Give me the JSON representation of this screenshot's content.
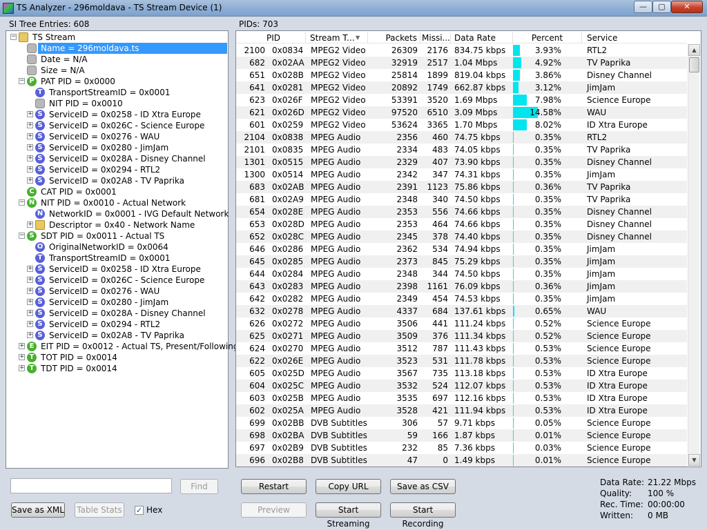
{
  "window": {
    "title": "TS Analyzer - 296moldava - TS Stream Device (1)",
    "minimize": "—",
    "maximize": "▢",
    "close": "✕"
  },
  "left": {
    "header": "SI Tree Entries: 608",
    "find_button": "Find",
    "save_xml_button": "Save as XML",
    "table_stats_button": "Table Stats",
    "hex_label": "Hex",
    "hex_checked": "✓",
    "search_value": ""
  },
  "tree": [
    {
      "label": "TS Stream",
      "icon": "folder",
      "letter": "",
      "color": "#e8c860",
      "level": 0,
      "exp": "−"
    },
    {
      "label": "Name = 296moldava.ts",
      "icon": "leaf",
      "letter": "",
      "color": "#b8b8b8",
      "level": 1,
      "exp": "",
      "sel": true
    },
    {
      "label": "Date = N/A",
      "icon": "leaf",
      "letter": "",
      "color": "#b8b8b8",
      "level": 1,
      "exp": ""
    },
    {
      "label": "Size = N/A",
      "icon": "leaf",
      "letter": "",
      "color": "#b8b8b8",
      "level": 1,
      "exp": ""
    },
    {
      "label": "PAT PID = 0x0000",
      "icon": "P",
      "letter": "P",
      "color": "#48b030",
      "level": 1,
      "exp": "−"
    },
    {
      "label": "TransportStreamID = 0x0001",
      "icon": "T",
      "letter": "T",
      "color": "#5860d8",
      "level": 2,
      "exp": ""
    },
    {
      "label": "NIT PID = 0x0010",
      "icon": "leaf",
      "letter": "",
      "color": "#b8b8b8",
      "level": 2,
      "exp": ""
    },
    {
      "label": "ServiceID = 0x0258 - ID Xtra Europe",
      "icon": "S",
      "letter": "S",
      "color": "#5860d8",
      "level": 2,
      "exp": "+"
    },
    {
      "label": "ServiceID = 0x026C - Science Europe",
      "icon": "S",
      "letter": "S",
      "color": "#5860d8",
      "level": 2,
      "exp": "+"
    },
    {
      "label": "ServiceID = 0x0276 - WAU",
      "icon": "S",
      "letter": "S",
      "color": "#5860d8",
      "level": 2,
      "exp": "+"
    },
    {
      "label": "ServiceID = 0x0280 - JimJam",
      "icon": "S",
      "letter": "S",
      "color": "#5860d8",
      "level": 2,
      "exp": "+"
    },
    {
      "label": "ServiceID = 0x028A - Disney Channel",
      "icon": "S",
      "letter": "S",
      "color": "#5860d8",
      "level": 2,
      "exp": "+"
    },
    {
      "label": "ServiceID = 0x0294 - RTL2",
      "icon": "S",
      "letter": "S",
      "color": "#5860d8",
      "level": 2,
      "exp": "+"
    },
    {
      "label": "ServiceID = 0x02A8 - TV Paprika",
      "icon": "S",
      "letter": "S",
      "color": "#5860d8",
      "level": 2,
      "exp": "+"
    },
    {
      "label": "CAT PID = 0x0001",
      "icon": "C",
      "letter": "C",
      "color": "#48b030",
      "level": 1,
      "exp": ""
    },
    {
      "label": "NIT PID = 0x0010 - Actual Network",
      "icon": "N",
      "letter": "N",
      "color": "#48b030",
      "level": 1,
      "exp": "−"
    },
    {
      "label": "NetworkID = 0x0001 - IVG Default Network",
      "icon": "N",
      "letter": "N",
      "color": "#5860d8",
      "level": 2,
      "exp": ""
    },
    {
      "label": "Descriptor = 0x40 - Network Name",
      "icon": "folder",
      "letter": "",
      "color": "#e8c860",
      "level": 2,
      "exp": "+"
    },
    {
      "label": "SDT PID = 0x0011 - Actual TS",
      "icon": "S",
      "letter": "S",
      "color": "#48b030",
      "level": 1,
      "exp": "−"
    },
    {
      "label": "OriginalNetworkID = 0x0064",
      "icon": "O",
      "letter": "O",
      "color": "#5860d8",
      "level": 2,
      "exp": ""
    },
    {
      "label": "TransportStreamID = 0x0001",
      "icon": "T",
      "letter": "T",
      "color": "#5860d8",
      "level": 2,
      "exp": ""
    },
    {
      "label": "ServiceID = 0x0258 - ID Xtra Europe",
      "icon": "S",
      "letter": "S",
      "color": "#5860d8",
      "level": 2,
      "exp": "+"
    },
    {
      "label": "ServiceID = 0x026C - Science Europe",
      "icon": "S",
      "letter": "S",
      "color": "#5860d8",
      "level": 2,
      "exp": "+"
    },
    {
      "label": "ServiceID = 0x0276 - WAU",
      "icon": "S",
      "letter": "S",
      "color": "#5860d8",
      "level": 2,
      "exp": "+"
    },
    {
      "label": "ServiceID = 0x0280 - JimJam",
      "icon": "S",
      "letter": "S",
      "color": "#5860d8",
      "level": 2,
      "exp": "+"
    },
    {
      "label": "ServiceID = 0x028A - Disney Channel",
      "icon": "S",
      "letter": "S",
      "color": "#5860d8",
      "level": 2,
      "exp": "+"
    },
    {
      "label": "ServiceID = 0x0294 - RTL2",
      "icon": "S",
      "letter": "S",
      "color": "#5860d8",
      "level": 2,
      "exp": "+"
    },
    {
      "label": "ServiceID = 0x02A8 - TV Paprika",
      "icon": "S",
      "letter": "S",
      "color": "#5860d8",
      "level": 2,
      "exp": "+"
    },
    {
      "label": "EIT PID = 0x0012 - Actual TS, Present/Following",
      "icon": "E",
      "letter": "E",
      "color": "#48b030",
      "level": 1,
      "exp": "+"
    },
    {
      "label": "TOT PID = 0x0014",
      "icon": "T",
      "letter": "T",
      "color": "#48b030",
      "level": 1,
      "exp": "+"
    },
    {
      "label": "TDT PID = 0x0014",
      "icon": "T",
      "letter": "T",
      "color": "#48b030",
      "level": 1,
      "exp": "+"
    }
  ],
  "right": {
    "header": "PIDs: 703",
    "columns": [
      "PID",
      "Stream T...",
      "Packets",
      "Missi...",
      "Data Rate",
      "Percent",
      "Service"
    ],
    "sort_arrow": "▼",
    "rows": [
      {
        "dec": "2100",
        "hex": "0x0834",
        "type": "MPEG2 Video",
        "packets": "26309",
        "missing": "2176",
        "rate": "834.75 kbps",
        "pct": "3.93%",
        "pctv": 3.93,
        "service": "RTL2"
      },
      {
        "dec": "682",
        "hex": "0x02AA",
        "type": "MPEG2 Video",
        "packets": "32919",
        "missing": "2517",
        "rate": "1.04 Mbps",
        "pct": "4.92%",
        "pctv": 4.92,
        "service": "TV Paprika"
      },
      {
        "dec": "651",
        "hex": "0x028B",
        "type": "MPEG2 Video",
        "packets": "25814",
        "missing": "1899",
        "rate": "819.04 kbps",
        "pct": "3.86%",
        "pctv": 3.86,
        "service": "Disney Channel"
      },
      {
        "dec": "641",
        "hex": "0x0281",
        "type": "MPEG2 Video",
        "packets": "20892",
        "missing": "1749",
        "rate": "662.87 kbps",
        "pct": "3.12%",
        "pctv": 3.12,
        "service": "JimJam"
      },
      {
        "dec": "623",
        "hex": "0x026F",
        "type": "MPEG2 Video",
        "packets": "53391",
        "missing": "3520",
        "rate": "1.69 Mbps",
        "pct": "7.98%",
        "pctv": 7.98,
        "service": "Science Europe"
      },
      {
        "dec": "621",
        "hex": "0x026D",
        "type": "MPEG2 Video",
        "packets": "97520",
        "missing": "6510",
        "rate": "3.09 Mbps",
        "pct": "14.58%",
        "pctv": 14.58,
        "service": "WAU"
      },
      {
        "dec": "601",
        "hex": "0x0259",
        "type": "MPEG2 Video",
        "packets": "53624",
        "missing": "3365",
        "rate": "1.70 Mbps",
        "pct": "8.02%",
        "pctv": 8.02,
        "service": "ID Xtra Europe"
      },
      {
        "dec": "2104",
        "hex": "0x0838",
        "type": "MPEG Audio",
        "packets": "2356",
        "missing": "460",
        "rate": "74.75 kbps",
        "pct": "0.35%",
        "pctv": 0.35,
        "service": "RTL2"
      },
      {
        "dec": "2101",
        "hex": "0x0835",
        "type": "MPEG Audio",
        "packets": "2334",
        "missing": "483",
        "rate": "74.05 kbps",
        "pct": "0.35%",
        "pctv": 0.35,
        "service": "TV Paprika"
      },
      {
        "dec": "1301",
        "hex": "0x0515",
        "type": "MPEG Audio",
        "packets": "2329",
        "missing": "407",
        "rate": "73.90 kbps",
        "pct": "0.35%",
        "pctv": 0.35,
        "service": "Disney Channel"
      },
      {
        "dec": "1300",
        "hex": "0x0514",
        "type": "MPEG Audio",
        "packets": "2342",
        "missing": "347",
        "rate": "74.31 kbps",
        "pct": "0.35%",
        "pctv": 0.35,
        "service": "JimJam"
      },
      {
        "dec": "683",
        "hex": "0x02AB",
        "type": "MPEG Audio",
        "packets": "2391",
        "missing": "1123",
        "rate": "75.86 kbps",
        "pct": "0.36%",
        "pctv": 0.36,
        "service": "TV Paprika"
      },
      {
        "dec": "681",
        "hex": "0x02A9",
        "type": "MPEG Audio",
        "packets": "2348",
        "missing": "340",
        "rate": "74.50 kbps",
        "pct": "0.35%",
        "pctv": 0.35,
        "service": "TV Paprika"
      },
      {
        "dec": "654",
        "hex": "0x028E",
        "type": "MPEG Audio",
        "packets": "2353",
        "missing": "556",
        "rate": "74.66 kbps",
        "pct": "0.35%",
        "pctv": 0.35,
        "service": "Disney Channel"
      },
      {
        "dec": "653",
        "hex": "0x028D",
        "type": "MPEG Audio",
        "packets": "2353",
        "missing": "464",
        "rate": "74.66 kbps",
        "pct": "0.35%",
        "pctv": 0.35,
        "service": "Disney Channel"
      },
      {
        "dec": "652",
        "hex": "0x028C",
        "type": "MPEG Audio",
        "packets": "2345",
        "missing": "378",
        "rate": "74.40 kbps",
        "pct": "0.35%",
        "pctv": 0.35,
        "service": "Disney Channel"
      },
      {
        "dec": "646",
        "hex": "0x0286",
        "type": "MPEG Audio",
        "packets": "2362",
        "missing": "534",
        "rate": "74.94 kbps",
        "pct": "0.35%",
        "pctv": 0.35,
        "service": "JimJam"
      },
      {
        "dec": "645",
        "hex": "0x0285",
        "type": "MPEG Audio",
        "packets": "2373",
        "missing": "845",
        "rate": "75.29 kbps",
        "pct": "0.35%",
        "pctv": 0.35,
        "service": "JimJam"
      },
      {
        "dec": "644",
        "hex": "0x0284",
        "type": "MPEG Audio",
        "packets": "2348",
        "missing": "344",
        "rate": "74.50 kbps",
        "pct": "0.35%",
        "pctv": 0.35,
        "service": "JimJam"
      },
      {
        "dec": "643",
        "hex": "0x0283",
        "type": "MPEG Audio",
        "packets": "2398",
        "missing": "1161",
        "rate": "76.09 kbps",
        "pct": "0.36%",
        "pctv": 0.36,
        "service": "JimJam"
      },
      {
        "dec": "642",
        "hex": "0x0282",
        "type": "MPEG Audio",
        "packets": "2349",
        "missing": "454",
        "rate": "74.53 kbps",
        "pct": "0.35%",
        "pctv": 0.35,
        "service": "JimJam"
      },
      {
        "dec": "632",
        "hex": "0x0278",
        "type": "MPEG Audio",
        "packets": "4337",
        "missing": "684",
        "rate": "137.61 kbps",
        "pct": "0.65%",
        "pctv": 0.65,
        "service": "WAU"
      },
      {
        "dec": "626",
        "hex": "0x0272",
        "type": "MPEG Audio",
        "packets": "3506",
        "missing": "441",
        "rate": "111.24 kbps",
        "pct": "0.52%",
        "pctv": 0.52,
        "service": "Science Europe"
      },
      {
        "dec": "625",
        "hex": "0x0271",
        "type": "MPEG Audio",
        "packets": "3509",
        "missing": "376",
        "rate": "111.34 kbps",
        "pct": "0.52%",
        "pctv": 0.52,
        "service": "Science Europe"
      },
      {
        "dec": "624",
        "hex": "0x0270",
        "type": "MPEG Audio",
        "packets": "3512",
        "missing": "787",
        "rate": "111.43 kbps",
        "pct": "0.53%",
        "pctv": 0.53,
        "service": "Science Europe"
      },
      {
        "dec": "622",
        "hex": "0x026E",
        "type": "MPEG Audio",
        "packets": "3523",
        "missing": "531",
        "rate": "111.78 kbps",
        "pct": "0.53%",
        "pctv": 0.53,
        "service": "Science Europe"
      },
      {
        "dec": "605",
        "hex": "0x025D",
        "type": "MPEG Audio",
        "packets": "3567",
        "missing": "735",
        "rate": "113.18 kbps",
        "pct": "0.53%",
        "pctv": 0.53,
        "service": "ID Xtra Europe"
      },
      {
        "dec": "604",
        "hex": "0x025C",
        "type": "MPEG Audio",
        "packets": "3532",
        "missing": "524",
        "rate": "112.07 kbps",
        "pct": "0.53%",
        "pctv": 0.53,
        "service": "ID Xtra Europe"
      },
      {
        "dec": "603",
        "hex": "0x025B",
        "type": "MPEG Audio",
        "packets": "3535",
        "missing": "697",
        "rate": "112.16 kbps",
        "pct": "0.53%",
        "pctv": 0.53,
        "service": "ID Xtra Europe"
      },
      {
        "dec": "602",
        "hex": "0x025A",
        "type": "MPEG Audio",
        "packets": "3528",
        "missing": "421",
        "rate": "111.94 kbps",
        "pct": "0.53%",
        "pctv": 0.53,
        "service": "ID Xtra Europe"
      },
      {
        "dec": "699",
        "hex": "0x02BB",
        "type": "DVB Subtitles",
        "packets": "306",
        "missing": "57",
        "rate": "9.71 kbps",
        "pct": "0.05%",
        "pctv": 0.05,
        "service": "Science Europe"
      },
      {
        "dec": "698",
        "hex": "0x02BA",
        "type": "DVB Subtitles",
        "packets": "59",
        "missing": "166",
        "rate": "1.87 kbps",
        "pct": "0.01%",
        "pctv": 0.01,
        "service": "Science Europe"
      },
      {
        "dec": "697",
        "hex": "0x02B9",
        "type": "DVB Subtitles",
        "packets": "232",
        "missing": "85",
        "rate": "7.36 kbps",
        "pct": "0.03%",
        "pctv": 0.03,
        "service": "Science Europe"
      },
      {
        "dec": "696",
        "hex": "0x02B8",
        "type": "DVB Subtitles",
        "packets": "47",
        "missing": "0",
        "rate": "1.49 kbps",
        "pct": "0.01%",
        "pctv": 0.01,
        "service": "Science Europe"
      }
    ]
  },
  "buttons": {
    "restart": "Restart",
    "copy_url": "Copy URL",
    "save_csv": "Save as CSV",
    "preview": "Preview",
    "start_streaming": "Start Streaming",
    "start_recording": "Start Recording"
  },
  "stats": {
    "data_rate_label": "Data Rate:",
    "data_rate_value": "21.22 Mbps",
    "quality_label": "Quality:",
    "quality_value": "100 %",
    "rec_time_label": "Rec. Time:",
    "rec_time_value": "00:00:00",
    "written_label": "Written:",
    "written_value": "0 MB"
  },
  "colors": {
    "bar": "#00e5ee",
    "selection": "#3399ff"
  }
}
